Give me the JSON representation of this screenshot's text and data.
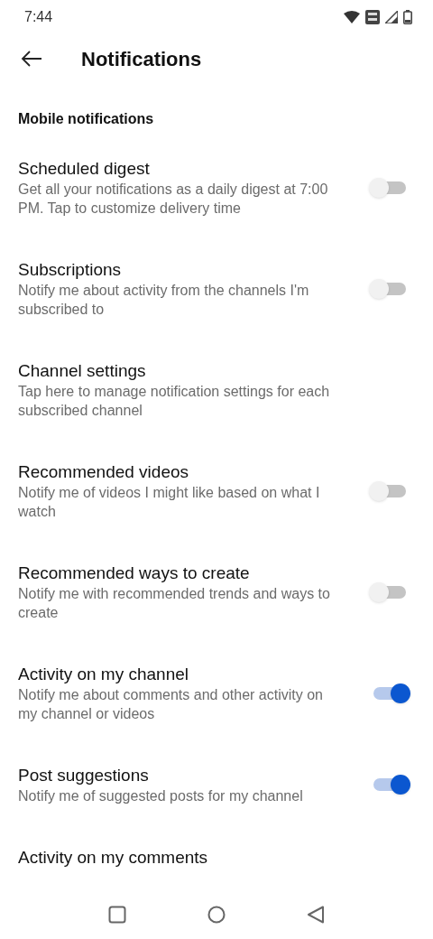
{
  "status_bar": {
    "time": "7:44"
  },
  "header": {
    "title": "Notifications"
  },
  "section": {
    "title": "Mobile notifications"
  },
  "items": [
    {
      "kind": "toggle",
      "title": "Scheduled digest",
      "description": "Get all your notifications as a daily digest at 7:00 PM. Tap to customize delivery time",
      "on": false
    },
    {
      "kind": "toggle",
      "title": "Subscriptions",
      "description": "Notify me about activity from the channels I'm subscribed to",
      "on": false
    },
    {
      "kind": "link",
      "title": "Channel settings",
      "description": "Tap here to manage notification settings for each subscribed channel"
    },
    {
      "kind": "toggle",
      "title": "Recommended videos",
      "description": "Notify me of videos I might like based on what I watch",
      "on": false
    },
    {
      "kind": "toggle",
      "title": "Recommended ways to create",
      "description": "Notify me with recommended trends and ways to create",
      "on": false
    },
    {
      "kind": "toggle",
      "title": "Activity on my channel",
      "description": "Notify me about comments and other activity on my channel or videos",
      "on": true
    },
    {
      "kind": "toggle",
      "title": "Post suggestions",
      "description": "Notify me of suggested posts for my channel",
      "on": true
    },
    {
      "kind": "link",
      "title": "Activity on my comments"
    }
  ]
}
